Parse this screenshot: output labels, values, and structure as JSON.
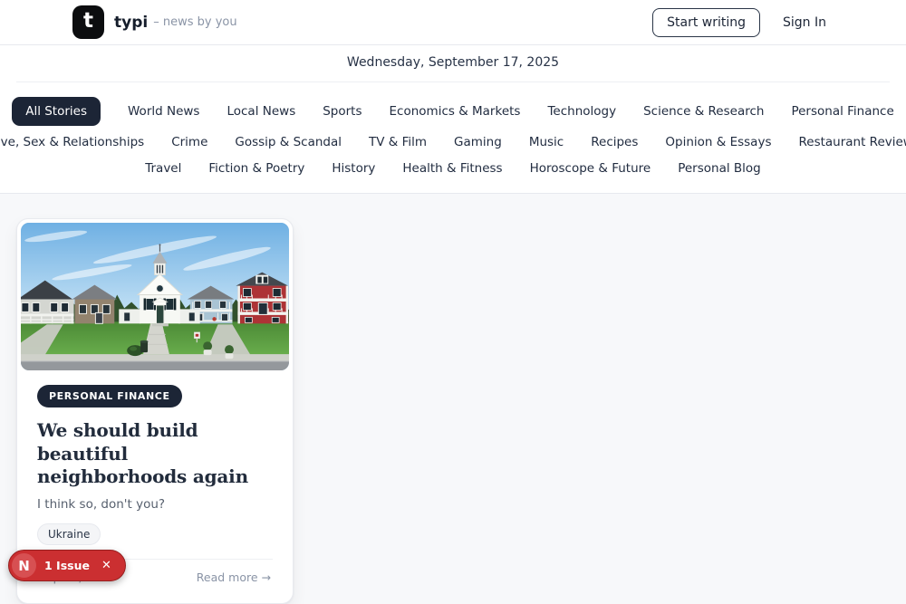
{
  "header": {
    "logo_letter": "t",
    "brand": "typi",
    "tagline": "– news by you",
    "start_writing_label": "Start writing",
    "sign_in_label": "Sign In"
  },
  "date_bar": {
    "date": "Wednesday, September 17, 2025"
  },
  "nav": {
    "active_item": "All Stories",
    "rows": [
      [
        "All Stories",
        "World News",
        "Local News",
        "Sports",
        "Economics & Markets",
        "Technology",
        "Science & Research",
        "Personal Finance"
      ],
      [
        "Love, Sex & Relationships",
        "Crime",
        "Gossip & Scandal",
        "TV & Film",
        "Gaming",
        "Music",
        "Recipes",
        "Opinion & Essays",
        "Restaurant Reviews"
      ],
      [
        "Travel",
        "Fiction & Poetry",
        "History",
        "Health & Fitness",
        "Horoscope & Future",
        "Personal Blog"
      ]
    ]
  },
  "article_card": {
    "category_badge": "PERSONAL FINANCE",
    "title": "We should build beautiful neighborhoods again",
    "subtitle": "I think so, don't you?",
    "tags": [
      "Ukraine"
    ],
    "date": "Sep 17, 2025",
    "read_more_label": "Read more →",
    "image_name": "neighborhood-houses-photo"
  },
  "dev_overlay": {
    "logo_letter": "N",
    "issues_label": "1 Issue",
    "close_label": "✕"
  },
  "colors": {
    "accent_dark": "#1c2536",
    "issue_red": "#cb2f31",
    "page_bg": "#f7f8fa",
    "muted_text": "#8a94a6",
    "header_border": "#e7e9ee"
  }
}
